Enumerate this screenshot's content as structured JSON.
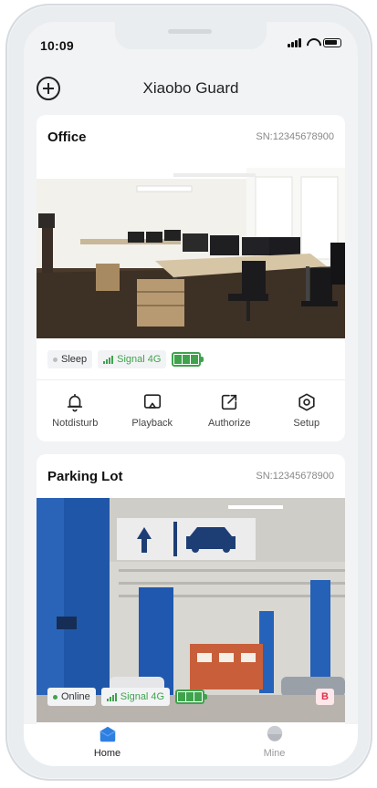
{
  "status_bar": {
    "time": "10:09"
  },
  "header": {
    "title": "Xiaobo Guard"
  },
  "devices": [
    {
      "name": "Office",
      "sn": "SN:12345678900",
      "status": "Sleep",
      "signal": "Signal 4G"
    },
    {
      "name": "Parking Lot",
      "sn": "SN:12345678900",
      "status": "Online",
      "signal": "Signal 4G",
      "badge": "B"
    }
  ],
  "actions": [
    {
      "label": "Notdisturb",
      "icon": "bell-icon"
    },
    {
      "label": "Playback",
      "icon": "playback-icon"
    },
    {
      "label": "Authorize",
      "icon": "share-icon"
    },
    {
      "label": "Setup",
      "icon": "settings-icon"
    }
  ],
  "tabs": [
    {
      "label": "Home",
      "icon": "home-icon"
    },
    {
      "label": "Mine",
      "icon": "profile-icon"
    }
  ],
  "colors": {
    "accent_green": "#3fa34d",
    "tab_active": "#2f7fe0",
    "badge_red": "#e0314b",
    "background": "#f2f3f5"
  }
}
